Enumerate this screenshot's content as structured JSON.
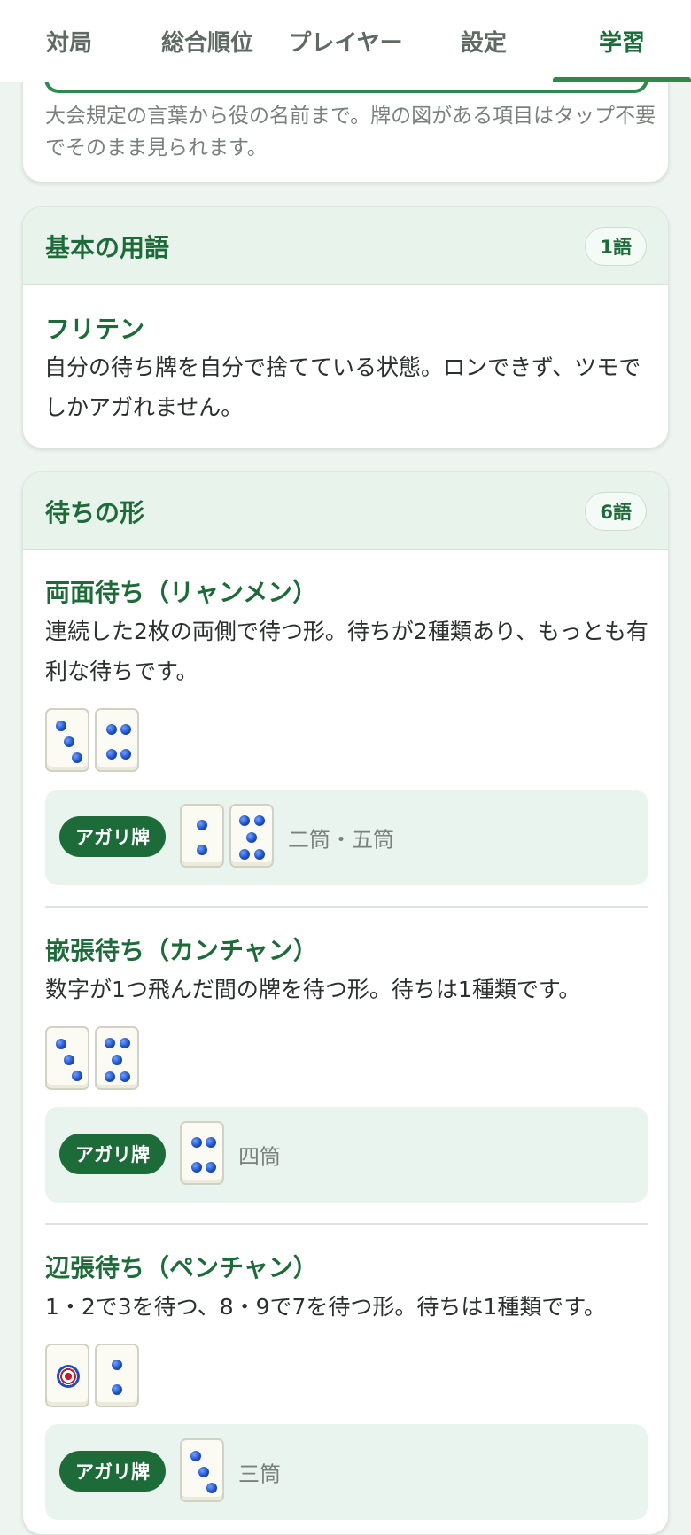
{
  "nav": {
    "tabs": [
      {
        "label": "対局"
      },
      {
        "label": "総合順位"
      },
      {
        "label": "プレイヤー"
      },
      {
        "label": "設定"
      },
      {
        "label": "学習"
      }
    ],
    "active_tab": "学習"
  },
  "intro": {
    "text": "大会規定の言葉から役の名前まで。牌の図がある項目はタップ不要でそのまま見られます。"
  },
  "categories": [
    {
      "title": "基本の用語",
      "count": "1語",
      "terms": [
        {
          "name": "フリテン",
          "description": "自分の待ち牌を自分で捨てている状態。ロンできず、ツモでしかアガれません。"
        }
      ]
    },
    {
      "title": "待ちの形",
      "count": "6語",
      "terms": [
        {
          "name": "両面待ち（リャンメン）",
          "description": "連続した2枚の両側で待つ形。待ちが2種類あり、もっとも有利な待ちです。",
          "hand_tiles": [
            "3p",
            "4p"
          ],
          "win_label": "アガリ牌",
          "win_tiles": [
            "2p",
            "5p"
          ],
          "win_text": "二筒・五筒"
        },
        {
          "name": "嵌張待ち（カンチャン）",
          "description": "数字が1つ飛んだ間の牌を待つ形。待ちは1種類です。",
          "hand_tiles": [
            "3p",
            "5p"
          ],
          "win_label": "アガリ牌",
          "win_tiles": [
            "4p"
          ],
          "win_text": "四筒"
        },
        {
          "name": "辺張待ち（ペンチャン）",
          "description": "1・2で3を待つ、8・9で7を待つ形。待ちは1種類です。",
          "hand_tiles": [
            "1p",
            "2p"
          ],
          "win_label": "アガリ牌",
          "win_tiles": [
            "3p"
          ],
          "win_text": "三筒"
        }
      ]
    }
  ],
  "colors": {
    "accent": "#1e6b3a",
    "accent_light": "#e8f3ec",
    "background": "#eef4f0",
    "tile_dot": "#1d4fc4",
    "tile_ring_red": "#c31d2a"
  }
}
